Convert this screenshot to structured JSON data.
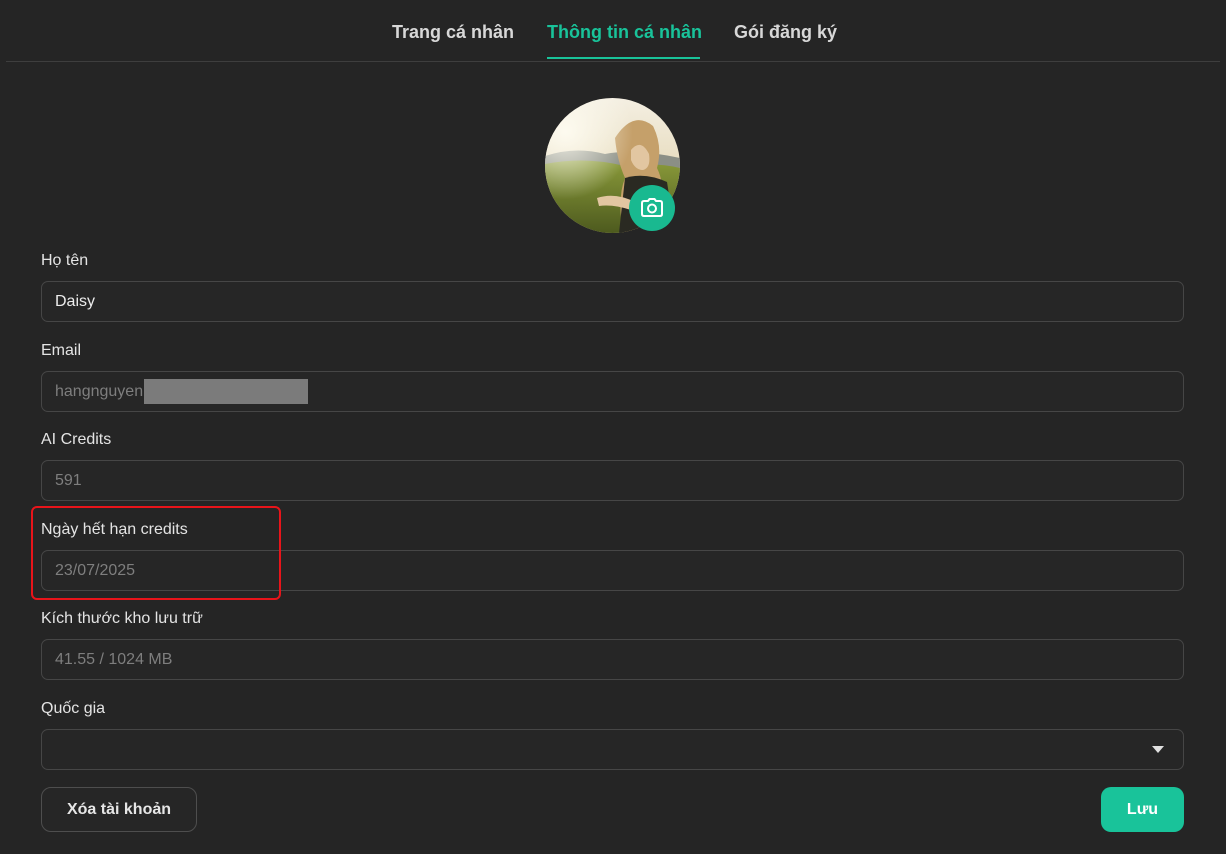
{
  "tabs": [
    {
      "label": "Trang cá nhân",
      "active": false
    },
    {
      "label": "Thông tin cá nhân",
      "active": true
    },
    {
      "label": "Gói đăng ký",
      "active": false
    }
  ],
  "colors": {
    "accent": "#19c39a",
    "background": "#252525",
    "highlight": "#e8141a"
  },
  "avatar": {
    "camera_icon": "camera-icon"
  },
  "form": {
    "name": {
      "label": "Họ tên",
      "value": "Daisy"
    },
    "email": {
      "label": "Email",
      "value": "hangnguyen"
    },
    "credits": {
      "label": "AI Credits",
      "value": "591"
    },
    "expiry": {
      "label": "Ngày hết hạn credits",
      "value": "23/07/2025"
    },
    "storage": {
      "label": "Kích thước kho lưu trữ",
      "value": "41.55 / 1024 MB"
    },
    "country": {
      "label": "Quốc gia",
      "value": ""
    }
  },
  "actions": {
    "delete_label": "Xóa tài khoản",
    "save_label": "Lưu"
  }
}
